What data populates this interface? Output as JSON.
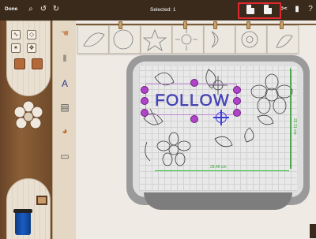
{
  "toolbar": {
    "done_label": "Done",
    "selected_label": "Selected: 1",
    "icons": [
      "search-icon",
      "undo-icon",
      "redo-icon",
      "copy-icon",
      "paste-icon",
      "cut-icon",
      "trash-icon",
      "help-icon"
    ]
  },
  "canvas": {
    "text_object": "FOLLOW",
    "width_label": "29.49 cm",
    "height_label": "22.31 cm"
  },
  "colors": {
    "highlight": "#e0282e",
    "selection_handle": "#b044c8",
    "text_stitch": "#4a46c0",
    "guide": "#2ec22e"
  }
}
